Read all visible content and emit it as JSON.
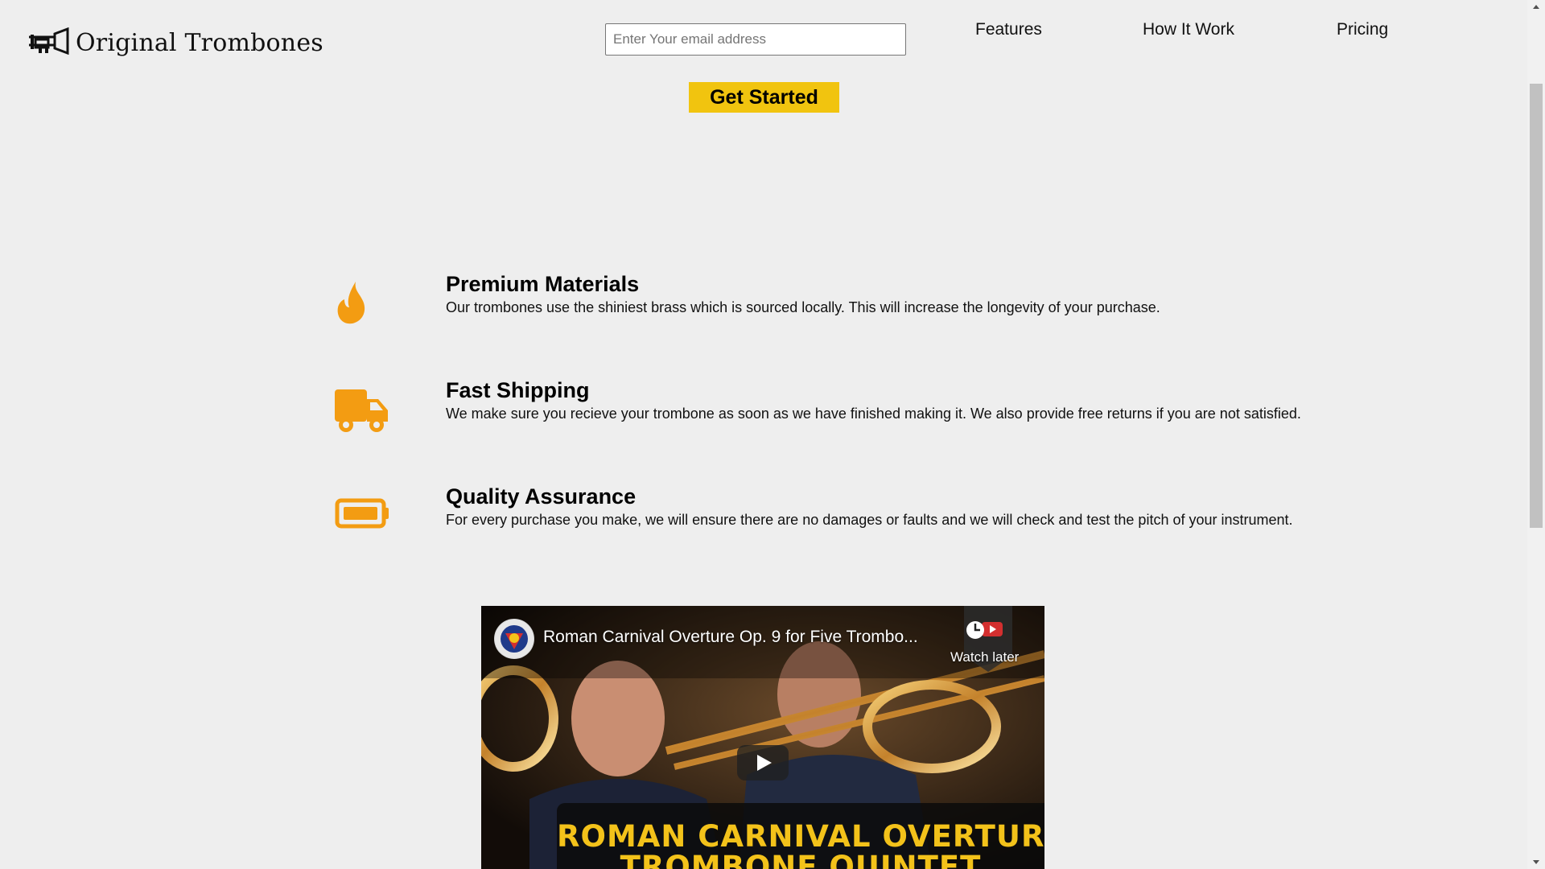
{
  "header": {
    "brand_name": "Original Trombones",
    "email_placeholder": "Enter Your email address",
    "cta_label": "Get Started",
    "nav": [
      "Features",
      "How It Work",
      "Pricing"
    ]
  },
  "features": [
    {
      "icon": "fire-icon",
      "title": "Premium Materials",
      "text": "Our trombones use the shiniest brass which is sourced locally. This will increase the longevity of your purchase."
    },
    {
      "icon": "truck-icon",
      "title": "Fast Shipping",
      "text": "We make sure you recieve your trombone as soon as we have finished making it. We also provide free returns if you are not satisfied."
    },
    {
      "icon": "battery-icon",
      "title": "Quality Assurance",
      "text": "For every purchase you make, we will ensure there are no damages or faults and we will check and test the pitch of your instrument."
    }
  ],
  "video": {
    "title": "Roman Carnival Overture Op. 9 for Five Trombo...",
    "watch_later": "Watch later",
    "banner_line1": "ROMAN CARNIVAL OVERTURE",
    "banner_line2": "TROMBONE QUINTET"
  },
  "colors": {
    "background": "#eeeeee",
    "accent": "#f1c40f",
    "icon": "#f39c12"
  }
}
